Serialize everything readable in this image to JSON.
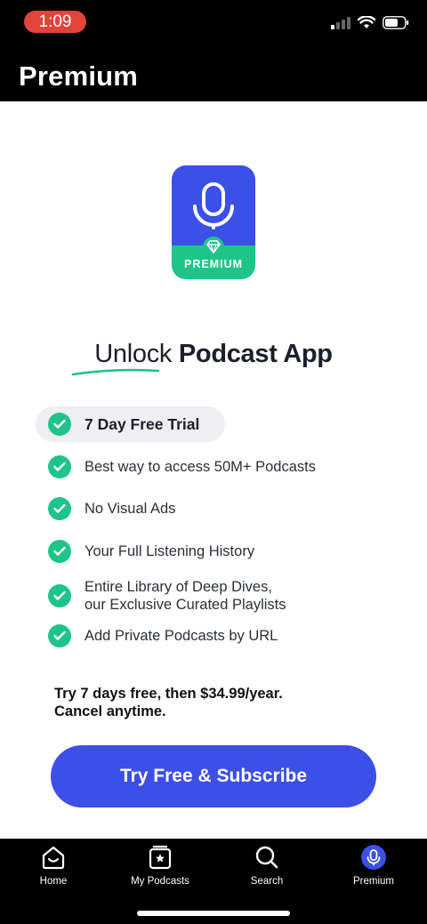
{
  "status_bar": {
    "time": "1:09"
  },
  "header": {
    "title": "Premium"
  },
  "logo": {
    "label": "PREMIUM"
  },
  "headline": {
    "light": "Unlock",
    "bold": "Podcast App"
  },
  "features": [
    "7 Day Free Trial",
    "Best way to access 50M+ Podcasts",
    "No Visual Ads",
    "Your Full Listening History",
    "Entire Library of Deep Dives,",
    "our Exclusive Curated Playlists",
    "Add Private Podcasts by URL"
  ],
  "pricing": {
    "line1": "Try 7 days free, then $34.99/year.",
    "line2": "Cancel anytime."
  },
  "cta": {
    "label": "Try Free & Subscribe"
  },
  "tabs": [
    {
      "label": "Home",
      "icon": "home-icon"
    },
    {
      "label": "My Podcasts",
      "icon": "my-podcasts-icon"
    },
    {
      "label": "Search",
      "icon": "search-icon"
    },
    {
      "label": "Premium",
      "icon": "premium-mic-icon"
    }
  ],
  "colors": {
    "brand_blue": "#3c4fe6",
    "accent_green": "#1ec48a",
    "time_pill": "#e0443a"
  }
}
